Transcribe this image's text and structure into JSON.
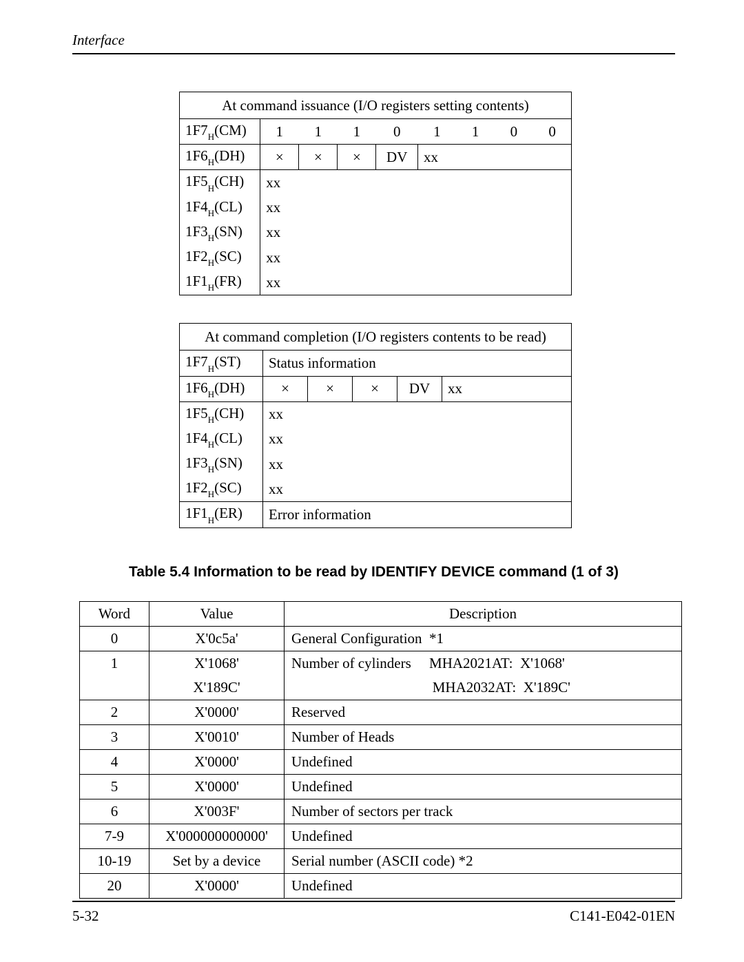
{
  "header": {
    "title": "Interface"
  },
  "issuance": {
    "title": "At command issuance (I/O registers setting contents)",
    "rows": {
      "cm": {
        "label": "1F7",
        "sub": "H",
        "suffix": "(CM)",
        "bits": [
          "1",
          "1",
          "1",
          "0",
          "1",
          "1",
          "0",
          "0"
        ]
      },
      "dh": {
        "label": "1F6",
        "sub": "H",
        "suffix": "(DH)",
        "cells": [
          "×",
          "×",
          "×",
          "DV",
          "xx"
        ]
      },
      "ch": {
        "label": "1F5",
        "sub": "H",
        "suffix": "(CH)",
        "val": "xx"
      },
      "cl": {
        "label": "1F4",
        "sub": "H",
        "suffix": "(CL)",
        "val": "xx"
      },
      "sn": {
        "label": "1F3",
        "sub": "H",
        "suffix": "(SN)",
        "val": "xx"
      },
      "sc": {
        "label": "1F2",
        "sub": "H",
        "suffix": "(SC)",
        "val": "xx"
      },
      "fr": {
        "label": "1F1",
        "sub": "H",
        "suffix": "(FR)",
        "val": "xx"
      }
    }
  },
  "completion": {
    "title": "At command completion (I/O registers contents to be read)",
    "rows": {
      "st": {
        "label": "1F7",
        "sub": "H",
        "suffix": "(ST)",
        "val": "Status information"
      },
      "dh": {
        "label": "1F6",
        "sub": "H",
        "suffix": "(DH)",
        "cells": [
          "×",
          "×",
          "×",
          "DV",
          "xx"
        ]
      },
      "ch": {
        "label": "1F5",
        "sub": "H",
        "suffix": "(CH)",
        "val": "xx"
      },
      "cl": {
        "label": "1F4",
        "sub": "H",
        "suffix": "(CL)",
        "val": "xx"
      },
      "sn": {
        "label": "1F3",
        "sub": "H",
        "suffix": "(SN)",
        "val": "xx"
      },
      "sc": {
        "label": "1F2",
        "sub": "H",
        "suffix": "(SC)",
        "val": "xx"
      },
      "er": {
        "label": "1F1",
        "sub": "H",
        "suffix": "(ER)",
        "val": "Error information"
      }
    }
  },
  "table_caption": "Table 5.4   Information to be read by IDENTIFY DEVICE command (1 of 3)",
  "id_table": {
    "headers": {
      "word": "Word",
      "value": "Value",
      "desc": "Description"
    },
    "rows": [
      {
        "word": "0",
        "value": "X'0c5a'",
        "desc": "General Configuration  *1"
      },
      {
        "word": "1",
        "value": "X'1068'",
        "desc": "Number of cylinders     MHA2021AT:  X'1068'"
      },
      {
        "word": "",
        "value": "X'189C'",
        "desc": "                                       MHA2032AT:  X'189C'"
      },
      {
        "word": "2",
        "value": "X'0000'",
        "desc": "Reserved"
      },
      {
        "word": "3",
        "value": "X'0010'",
        "desc": "Number of Heads"
      },
      {
        "word": "4",
        "value": "X'0000'",
        "desc": "Undefined"
      },
      {
        "word": "5",
        "value": "X'0000'",
        "desc": "Undefined"
      },
      {
        "word": "6",
        "value": "X'003F'",
        "desc": "Number of sectors per track"
      },
      {
        "word": "7-9",
        "value": "X'000000000000'",
        "desc": "Undefined"
      },
      {
        "word": "10-19",
        "value": "Set by a device",
        "desc": "Serial number (ASCII code) *2"
      },
      {
        "word": "20",
        "value": "X'0000'",
        "desc": "Undefined"
      }
    ]
  },
  "footer": {
    "left": "5-32",
    "right": "C141-E042-01EN"
  }
}
